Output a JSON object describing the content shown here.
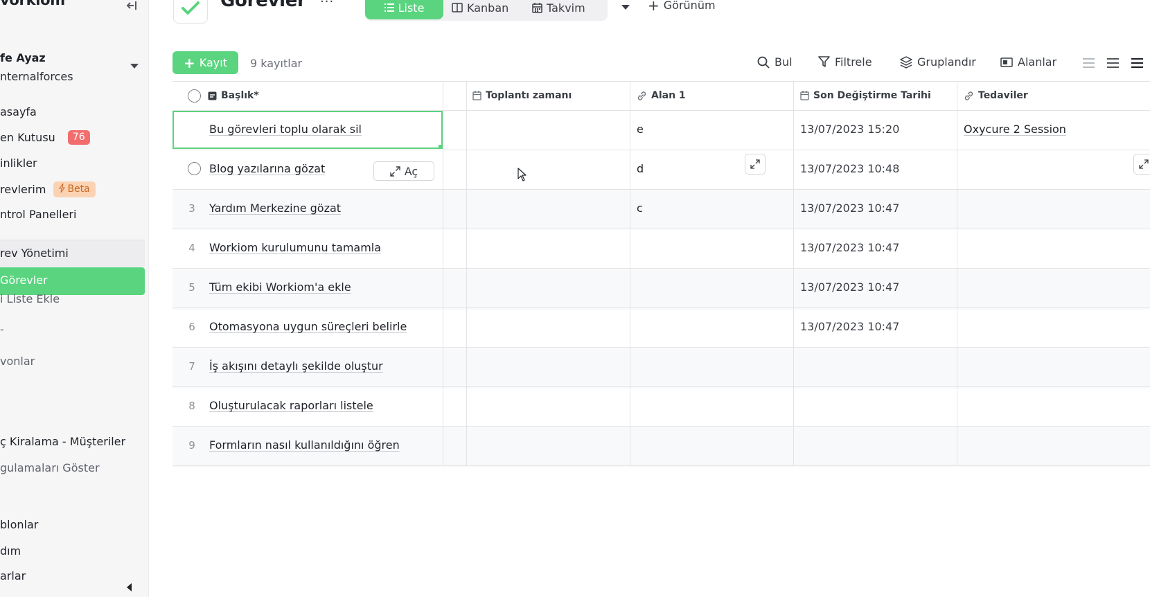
{
  "sidebar": {
    "brand": "vorkiom",
    "user_name": "fe Ayaz",
    "user_org": "nternalforces",
    "items": [
      {
        "label": "asayfa"
      },
      {
        "label": "en Kutusu",
        "badge": "76"
      },
      {
        "label": "inlikler"
      },
      {
        "label": "revlerim",
        "badge": "Beta"
      },
      {
        "label": "ntrol Panelleri"
      }
    ],
    "section_label": "rev Yönetimi",
    "active_label": "Görevler",
    "add_list_label": "i Liste Ekle",
    "misc_item": "-",
    "integrations_label": "vonlar",
    "app_rental_label": "ç Kiralama - Müşteriler",
    "show_apps_label": "gulamaları Göster",
    "bottom_items": [
      {
        "label": "blonlar"
      },
      {
        "label": "dım"
      },
      {
        "label": "arlar"
      }
    ]
  },
  "header": {
    "title": "Görevler",
    "more_label": "···",
    "views": [
      {
        "label": "Liste",
        "icon": "list-icon"
      },
      {
        "label": "Kanban",
        "icon": "kanban-icon"
      },
      {
        "label": "Takvim",
        "icon": "calendar-icon"
      }
    ],
    "add_view_label": "Görünüm"
  },
  "toolbar": {
    "add_label": "Kayıt",
    "record_count": "9 kayıtlar",
    "search_label": "Bul",
    "filter_label": "Filtrele",
    "group_label": "Gruplandır",
    "fields_label": "Alanlar"
  },
  "table": {
    "columns": [
      {
        "label": "Başlık*",
        "icon": "text-field-icon"
      },
      {
        "label": "Toplantı zamanı",
        "icon": "calendar-icon"
      },
      {
        "label": "Alan 1",
        "icon": "link-icon"
      },
      {
        "label": "Son Değiştirme Tarihi",
        "icon": "calendar-icon"
      },
      {
        "label": "Tedaviler",
        "icon": "link-icon"
      }
    ],
    "open_label": "Aç",
    "rows": [
      {
        "num": "",
        "title": "Bu görevleri toplu olarak sil",
        "meeting": "",
        "field1": "e",
        "modified": "13/07/2023 15:20",
        "treatments": "Oxycure 2 Session"
      },
      {
        "num": "",
        "title": "Blog yazılarına gözat",
        "meeting": "",
        "field1": "d",
        "modified": "13/07/2023 10:48",
        "treatments": ""
      },
      {
        "num": "3",
        "title": "Yardım Merkezine gözat",
        "meeting": "",
        "field1": "c",
        "modified": "13/07/2023 10:47",
        "treatments": ""
      },
      {
        "num": "4",
        "title": "Workiom kurulumunu tamamla",
        "meeting": "",
        "field1": "",
        "modified": "13/07/2023 10:47",
        "treatments": ""
      },
      {
        "num": "5",
        "title": "Tüm ekibi Workiom'a ekle",
        "meeting": "",
        "field1": "",
        "modified": "13/07/2023 10:47",
        "treatments": ""
      },
      {
        "num": "6",
        "title": "Otomasyona uygun süreçleri belirle",
        "meeting": "",
        "field1": "",
        "modified": "13/07/2023 10:47",
        "treatments": ""
      },
      {
        "num": "7",
        "title": "İş akışını detaylı şekilde oluştur",
        "meeting": "",
        "field1": "",
        "modified": "",
        "treatments": ""
      },
      {
        "num": "8",
        "title": "Oluşturulacak raporları listele",
        "meeting": "",
        "field1": "",
        "modified": "",
        "treatments": ""
      },
      {
        "num": "9",
        "title": "Formların nasıl kullanıldığını öğren",
        "meeting": "",
        "field1": "",
        "modified": "",
        "treatments": ""
      }
    ]
  },
  "colors": {
    "accent": "#5ad47f",
    "badge_red": "#f26d6d",
    "beta_bg": "#fbd3b3",
    "beta_text": "#c66a26"
  }
}
